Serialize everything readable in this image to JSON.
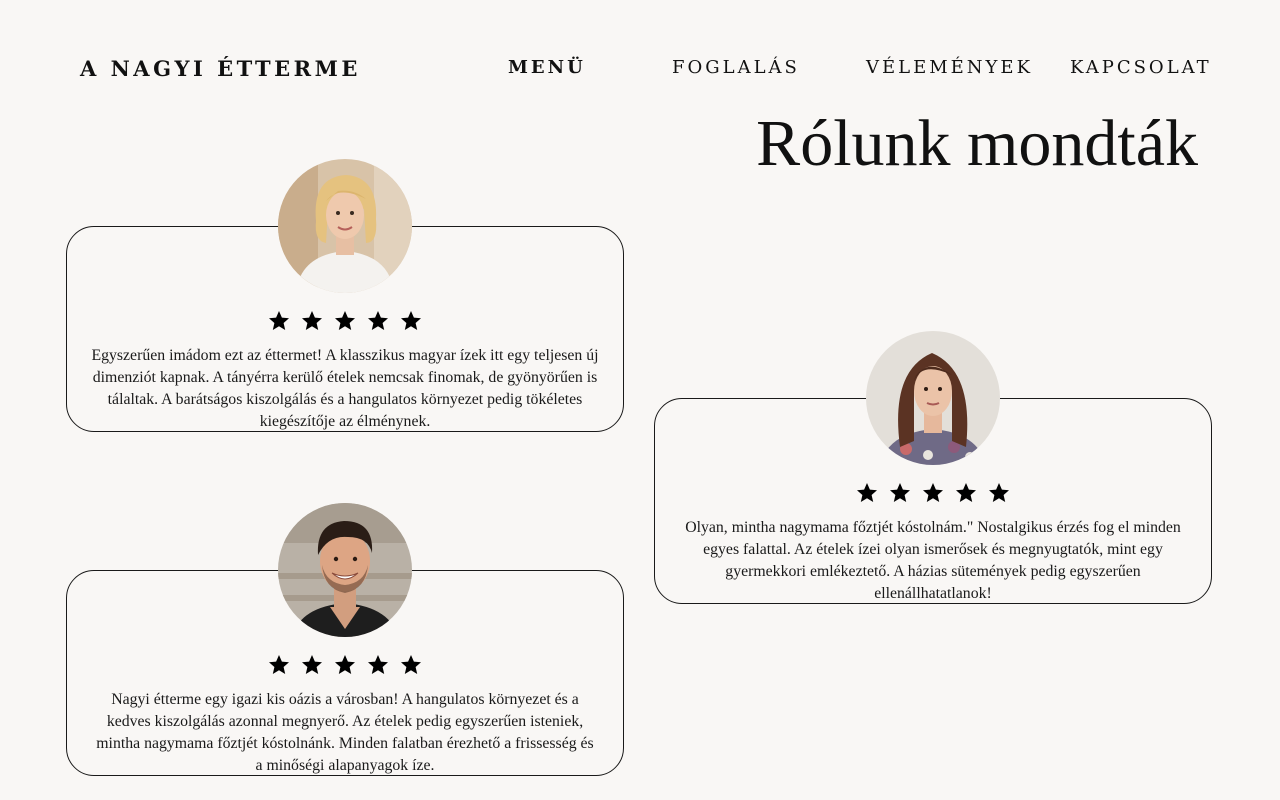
{
  "site": {
    "logo": "A NAGYI ÉTTERME"
  },
  "nav": {
    "items": [
      {
        "label": "MENÜ",
        "active": true
      },
      {
        "label": "FOGLALÁS",
        "active": false
      },
      {
        "label": "VÉLEMÉNYEK",
        "active": false
      },
      {
        "label": "KAPCSOLAT",
        "active": false
      }
    ]
  },
  "page": {
    "title": "Rólunk mondták"
  },
  "reviews": [
    {
      "rating": 5,
      "avatar_icon": "woman-blonde-portrait",
      "text": "Egyszerűen imádom ezt az éttermet! A klasszikus magyar ízek itt egy teljesen új dimenziót kapnak. A tányérra kerülő ételek nemcsak finomak, de gyönyörűen is tálaltak. A barátságos kiszolgálás és a hangulatos környezet pedig tökéletes kiegészítője az élménynek."
    },
    {
      "rating": 5,
      "avatar_icon": "man-smiling-portrait",
      "text": "Nagyi étterme egy igazi kis oázis a városban! A hangulatos környezet és a kedves kiszolgálás azonnal megnyerő. Az ételek pedig egyszerűen isteniek, mintha nagymama főztjét kóstolnánk. Minden falatban érezhető a frissesség és a minőségi alapanyagok íze."
    },
    {
      "rating": 5,
      "avatar_icon": "woman-brunette-portrait",
      "text": "Olyan, mintha nagymama főztjét kóstolnám.\" Nostalgikus érzés fog el minden egyes falattal. Az ételek ízei olyan ismerősek és megnyugtatók, mint egy gyermekkori emlékeztető. A házias sütemények pedig egyszerűen ellenállhatatlanok!"
    }
  ],
  "colors": {
    "background": "#f9f7f5",
    "text": "#111111",
    "card_border": "#1a1a1a",
    "star": "#000000"
  }
}
